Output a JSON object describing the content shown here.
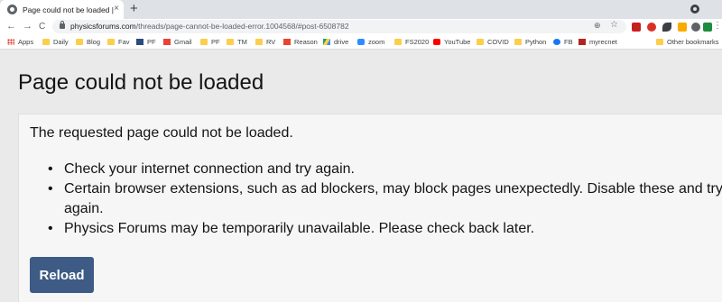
{
  "browser": {
    "tab": {
      "title": "Page could not be loaded | Physics Forums",
      "close": "×"
    },
    "new_tab": "+",
    "nav": {
      "back": "←",
      "forward": "→",
      "reload": "C"
    },
    "url": {
      "host": "physicsforums.com",
      "path": "/threads/page-cannot-be-loaded-error.1004568/#post-6508782"
    },
    "omnibox_icons": {
      "zoom": "⊕",
      "star": "☆"
    },
    "menu": "⋮"
  },
  "bookmarks": {
    "items": [
      {
        "label": "Apps",
        "icon": "apps-grid-icon"
      },
      {
        "label": "Daily",
        "icon": "folder-icon"
      },
      {
        "label": "Blog",
        "icon": "folder-icon"
      },
      {
        "label": "Fav",
        "icon": "folder-icon"
      },
      {
        "label": "PF",
        "icon": "pf-icon"
      },
      {
        "label": "Gmail",
        "icon": "gmail-icon"
      },
      {
        "label": "PF",
        "icon": "folder-icon"
      },
      {
        "label": "TM",
        "icon": "folder-icon"
      },
      {
        "label": "RV",
        "icon": "folder-icon"
      },
      {
        "label": "Reason",
        "icon": "reason-icon"
      },
      {
        "label": "drive",
        "icon": "drive-icon"
      },
      {
        "label": "zoom",
        "icon": "zoom-icon"
      },
      {
        "label": "FS2020",
        "icon": "folder-icon"
      },
      {
        "label": "YouTube",
        "icon": "youtube-icon"
      },
      {
        "label": "COVID",
        "icon": "folder-icon"
      },
      {
        "label": "Python",
        "icon": "folder-icon"
      },
      {
        "label": "FB",
        "icon": "facebook-icon"
      },
      {
        "label": "myrecnet",
        "icon": "myrecnet-icon"
      }
    ],
    "other": "Other bookmarks"
  },
  "page": {
    "title": "Page could not be loaded",
    "message": "The requested page could not be loaded.",
    "reasons": [
      "Check your internet connection and try again.",
      "Certain browser extensions, such as ad blockers, may block pages unexpectedly. Disable these and try again.",
      "Physics Forums may be temporarily unavailable. Please check back later."
    ],
    "reload_label": "Reload"
  },
  "colors": {
    "reload_button": "#3d5b85",
    "page_background": "#eaeaea",
    "block_background": "#f6f6f6"
  }
}
